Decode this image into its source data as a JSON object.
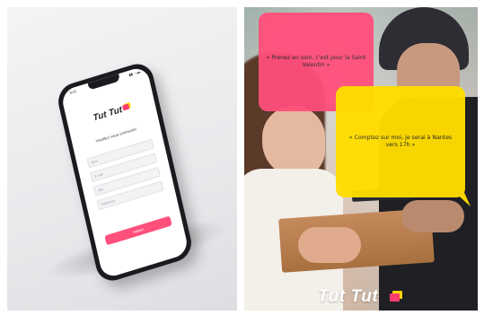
{
  "phone": {
    "status_time": "9:41",
    "status_icons": "▮▮ ◔ ▬",
    "logo_text": "Tut Tut",
    "form_title": "Veuillez vous connecter",
    "fields": [
      "Nom",
      "E-mail",
      "Ville",
      "Téléphone"
    ],
    "submit_label": "Valider"
  },
  "photo": {
    "bubble_pink_text": "« Prenez en soin, c'est pour la Saint Valentin »",
    "bubble_yellow_text": "« Comptez sur moi, je serai à Nantes vers 17h »",
    "brand_text": "Tut Tut"
  },
  "colors": {
    "brand_pink": "#ff4f7b",
    "brand_yellow": "#ffdd00",
    "phone_frame": "#1b1b1f"
  }
}
